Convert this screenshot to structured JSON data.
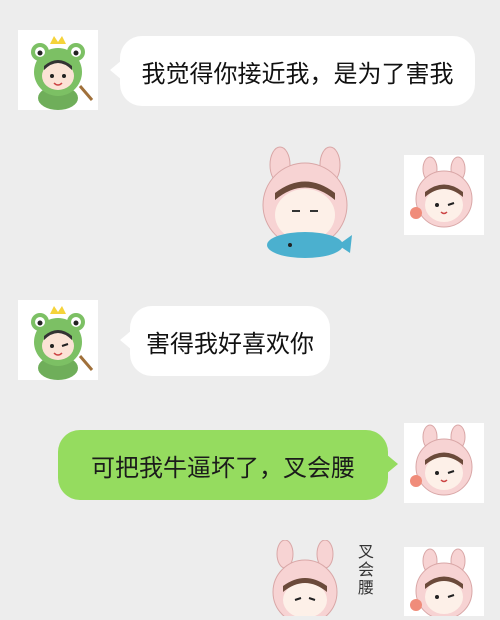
{
  "chat": {
    "messages": [
      {
        "sender": "left",
        "text": "我觉得你接近我，是为了害我"
      },
      {
        "sender": "right",
        "type": "sticker",
        "sticker_name": "girl-hugging-whale-sticker"
      },
      {
        "sender": "left",
        "text": "害得我好喜欢你"
      },
      {
        "sender": "right",
        "text": "可把我牛逼坏了，叉会腰"
      },
      {
        "sender": "right",
        "type": "sticker",
        "sticker_name": "girl-hands-on-hips-sticker",
        "caption": "叉会腰"
      }
    ]
  },
  "colors": {
    "background": "#ededed",
    "bubble_white": "#ffffff",
    "bubble_green": "#95dc5f"
  },
  "avatars": {
    "left": "frog-boy-avatar",
    "right": "bunny-girl-avatar"
  }
}
